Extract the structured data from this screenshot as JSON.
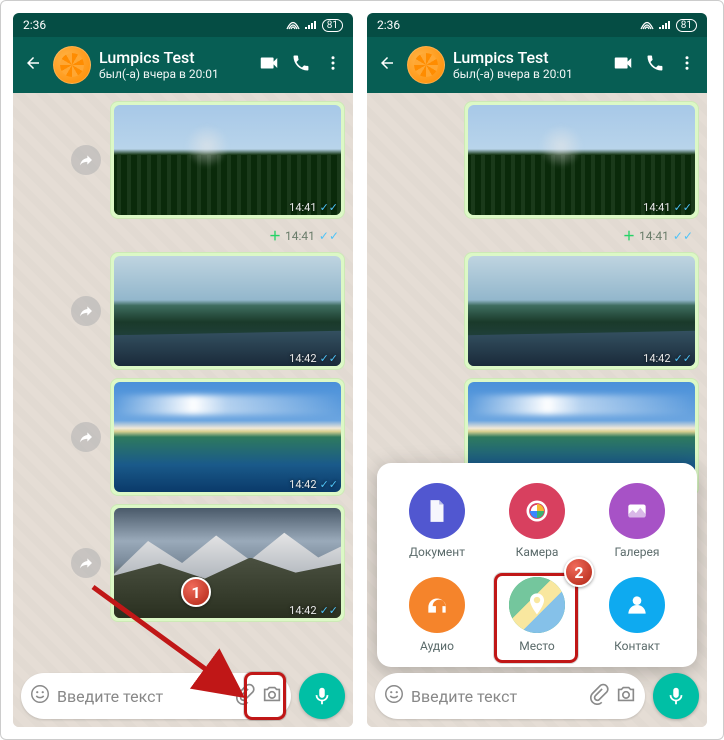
{
  "statusbar": {
    "time": "2:36",
    "battery": "81"
  },
  "header": {
    "contact_name": "Lumpics Test",
    "last_seen": "был(-а) вчера в 20:01"
  },
  "messages": {
    "img1_time": "14:41",
    "plus_time": "14:41",
    "img2_time": "14:42",
    "img3_time": "14:42",
    "img4_time": "14:42"
  },
  "input": {
    "placeholder": "Введите текст"
  },
  "attach": {
    "document": "Документ",
    "camera": "Камера",
    "gallery": "Галерея",
    "audio": "Аудио",
    "location": "Место",
    "contact": "Контакт"
  },
  "callouts": {
    "one": "1",
    "two": "2"
  }
}
